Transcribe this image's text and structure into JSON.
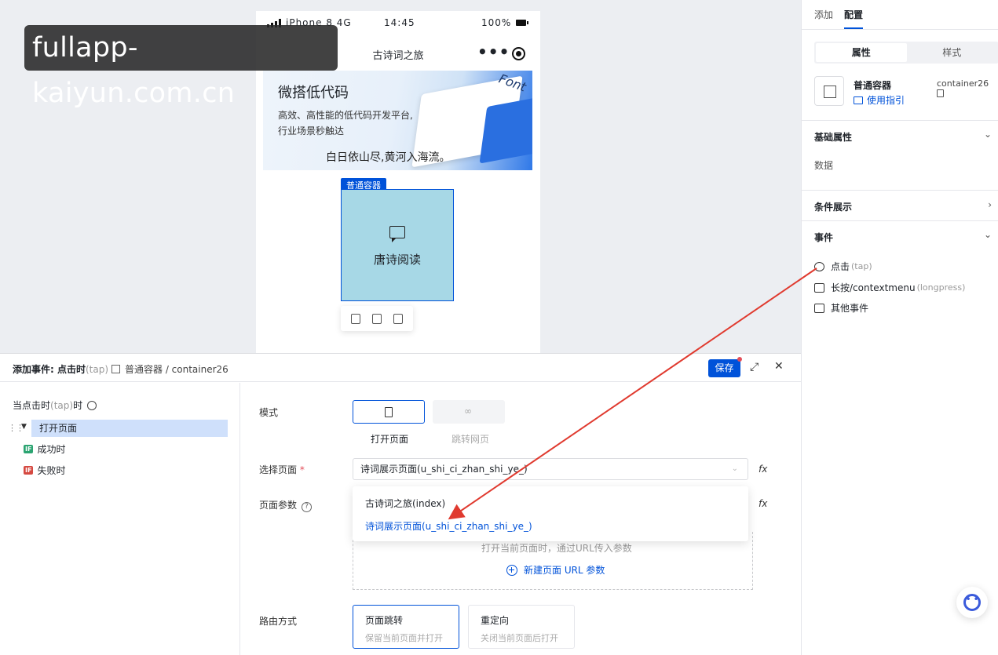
{
  "watermark": "fullapp-kaiyun.com.cn",
  "phone": {
    "carrier": "iPhone 8 4G",
    "time": "14:45",
    "battery": "100%",
    "nav_title": "古诗词之旅",
    "more_icon": "•••",
    "banner": {
      "title": "微搭低代码",
      "desc_line1": "高效、高性能的低代码开发平台,",
      "desc_line2": "行业场景秒触达",
      "poem": "白日依山尽,黄河入海流。",
      "decor_text": "Font"
    },
    "selected": {
      "tag": "普通容器",
      "label": "唐诗阅读"
    }
  },
  "right_panel": {
    "tabs": [
      "添加",
      "配置"
    ],
    "active_tab": "配置",
    "segments": [
      "属性",
      "样式"
    ],
    "component_name": "普通容器",
    "component_id": "container26",
    "guide_link": "使用指引",
    "sections": {
      "basic": "基础属性",
      "data_label": "数据",
      "condition": "条件展示",
      "events": "事件"
    },
    "events": [
      {
        "label": "点击",
        "sub": "(tap)"
      },
      {
        "label": "长按/contextmenu",
        "sub": "(longpress)"
      },
      {
        "label": "其他事件",
        "sub": ""
      }
    ],
    "accent": "#0052d9"
  },
  "dialog": {
    "title": "添加事件: 点击时",
    "title_sub": "(tap)",
    "path": "普通容器 / container26",
    "save": "保存",
    "tree": {
      "root": "当点击时",
      "root_sub": "(tap)",
      "root_suffix": "时",
      "action": "打开页面",
      "success_tag": "IF",
      "success": "成功时",
      "fail_tag": "IF",
      "fail": "失败时"
    },
    "form": {
      "mode_label": "模式",
      "mode_open": "打开页面",
      "mode_jump": "跳转网页",
      "page_label": "选择页面",
      "page_required": "*",
      "page_value": "诗词展示页面(u_shi_ci_zhan_shi_ye_)",
      "params_label": "页面参数",
      "dropdown_options": [
        "古诗词之旅(index)",
        "诗词展示页面(u_shi_ci_zhan_shi_ye_)"
      ],
      "params_hint": "打开当前页面时，通过URL传入参数",
      "add_param": "新建页面 URL 参数",
      "route_label": "路由方式",
      "route_options": [
        {
          "title": "页面跳转",
          "desc": "保留当前页面并打开"
        },
        {
          "title": "重定向",
          "desc": "关闭当前页面后打开"
        }
      ],
      "fx": "fx"
    }
  }
}
